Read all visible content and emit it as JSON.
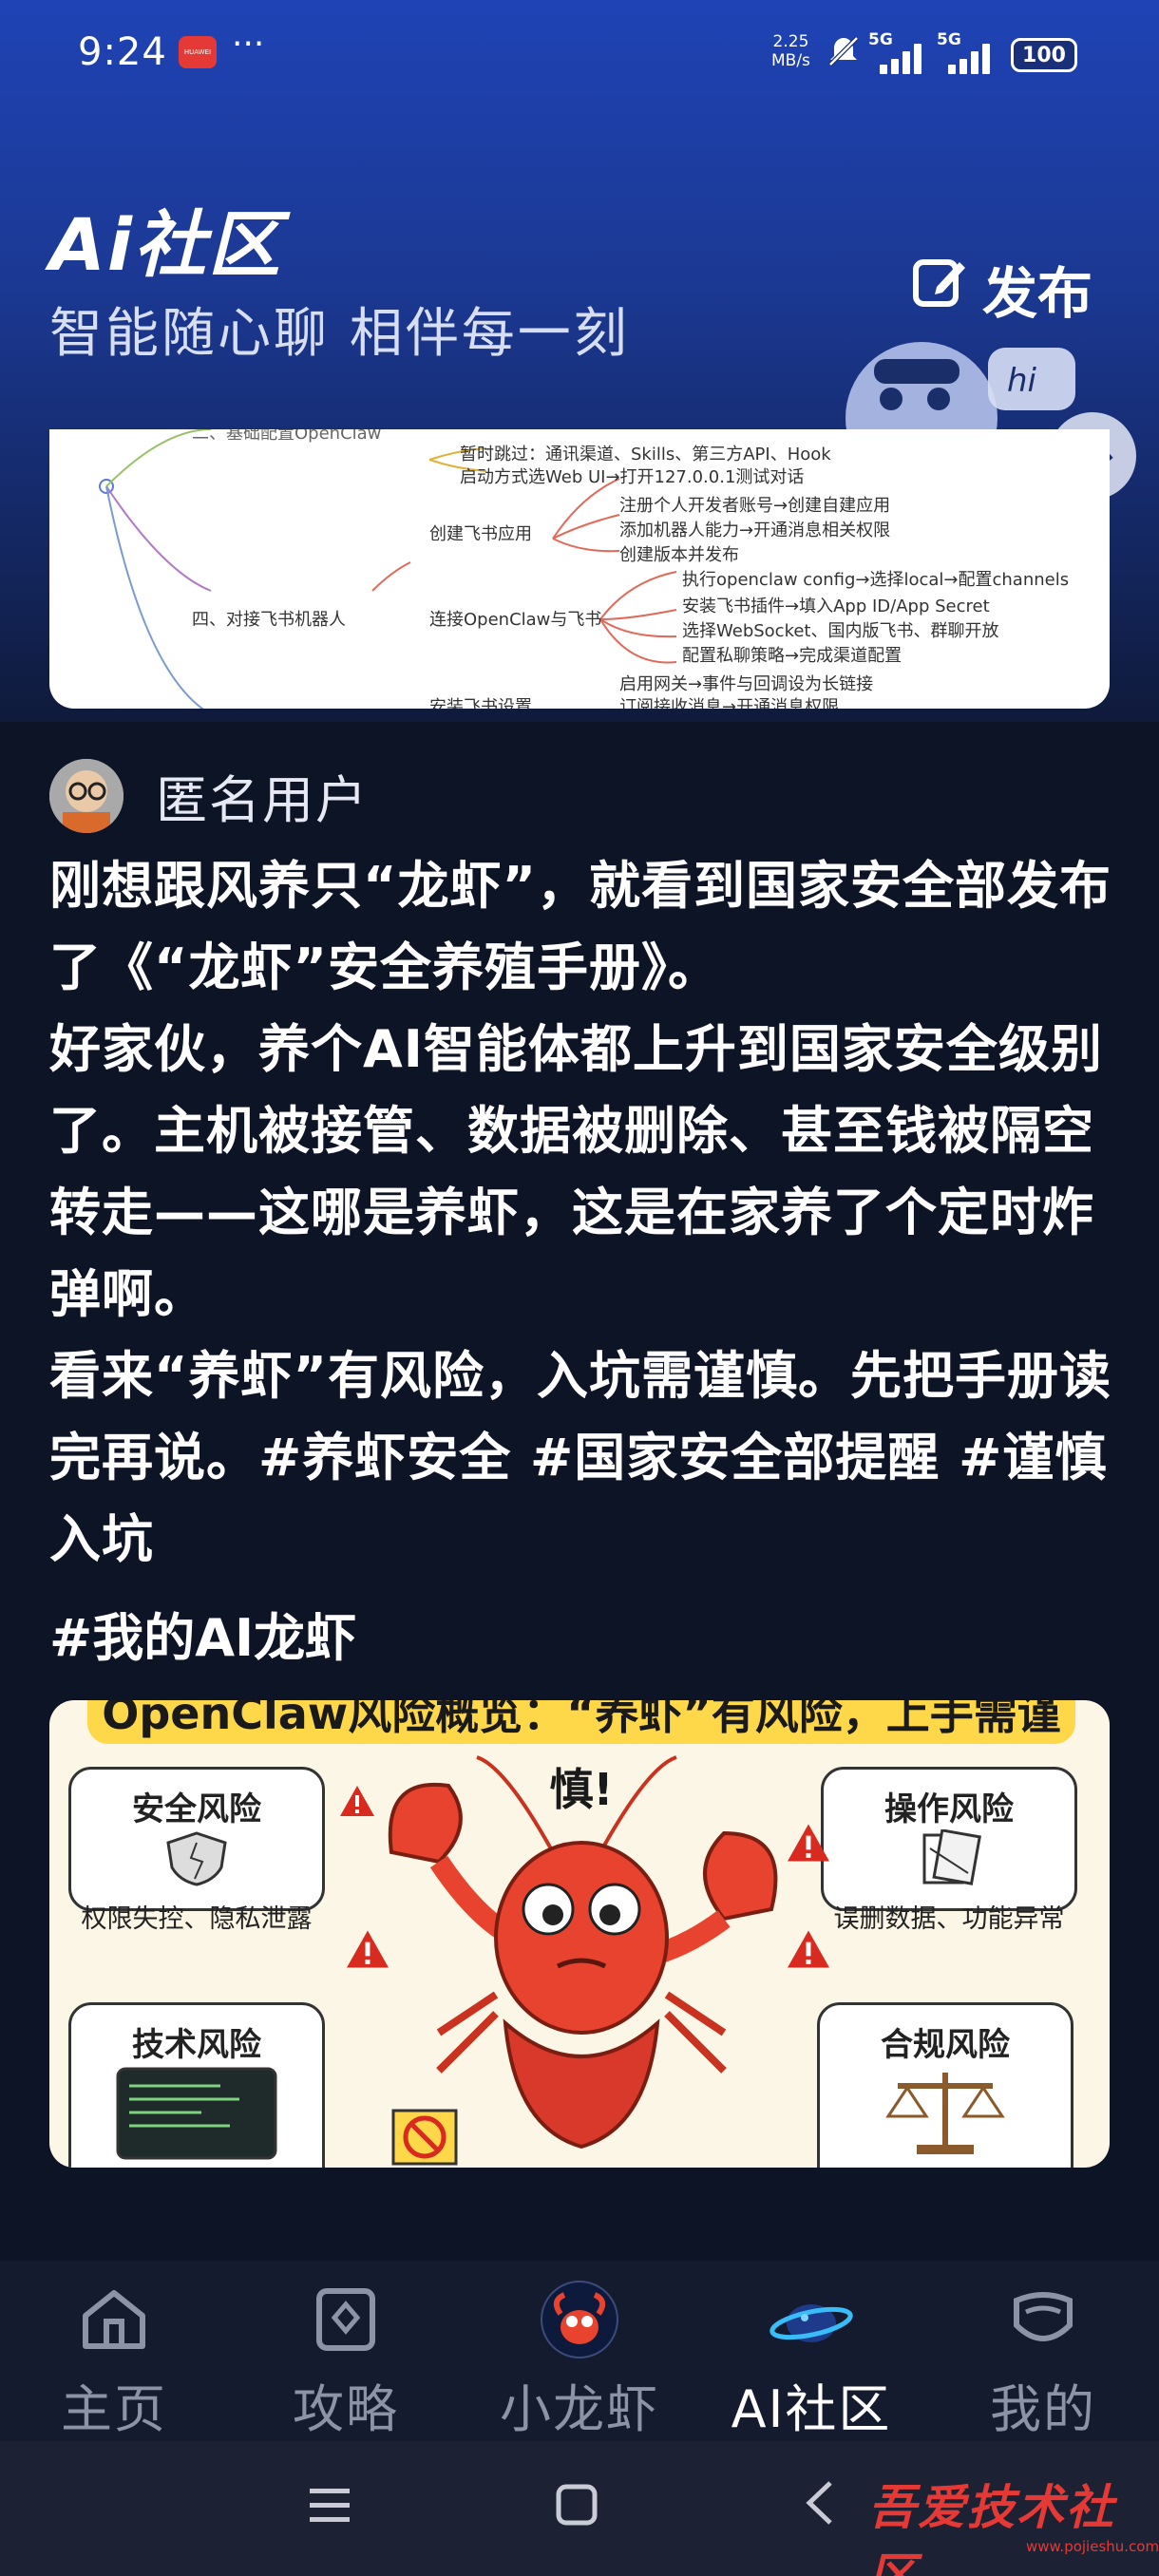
{
  "status_bar": {
    "time": "9:24",
    "app_badge": "HUAWEI",
    "more": "···",
    "net_speed_value": "2.25",
    "net_speed_unit": "MB/s",
    "signal1_label": "5G",
    "signal2_label": "5G",
    "battery": "100"
  },
  "header": {
    "logo": "Ai社区",
    "slogan": "智能随心聊 相伴每一刻",
    "publish_label": "发布"
  },
  "mindmap": {
    "lines": [
      "二、基础配置OpenClaw",
      "暂时跳过：通讯渠道、Skills、第三方API、Hook",
      "启动方式选Web UI→打开127.0.0.1测试对话",
      "注册个人开发者账号→创建自建应用",
      "创建飞书应用",
      "添加机器人能力→开通消息相关权限",
      "创建版本并发布",
      "执行openclaw config→选择local→配置channels",
      "四、对接飞书机器人",
      "连接OpenClaw与飞书",
      "安装飞书插件→填入App ID/App Secret",
      "选择WebSocket、国内版飞书、群聊开放",
      "配置私聊策略→完成渠道配置",
      "启用网关→事件与回调设为长链接",
      "安装飞书设置",
      "订阅接收消息→开通消息权限"
    ]
  },
  "post": {
    "author": "匿名用户",
    "paragraphs": [
      "刚想跟风养只“龙虾”，就看到国家安全部发布了《“龙虾”安全养殖手册》。",
      "好家伙，养个AI智能体都上升到国家安全级别了。主机被接管、数据被删除、甚至钱被隔空转走——这哪是养虾，这是在家养了个定时炸弹啊。",
      "看来“养虾”有风险，入坑需谨慎。先把手册读完再说。#养虾安全 #国家安全部提醒 #谨慎入坑"
    ],
    "topic": "#我的AI龙虾"
  },
  "poster": {
    "banner": "OpenClaw风险概览：“养虾”有风险，上手需谨慎!",
    "risks": [
      {
        "title": "安全风险",
        "desc": "权限失控、隐私泄露"
      },
      {
        "title": "操作风险",
        "desc": "误删数据、功能异常"
      },
      {
        "title": "技术风险",
        "desc": ""
      },
      {
        "title": "合规风险",
        "desc": ""
      }
    ]
  },
  "nav": {
    "items": [
      {
        "label": "主页",
        "icon": "home-icon"
      },
      {
        "label": "攻略",
        "icon": "guide-icon"
      },
      {
        "label": "小龙虾",
        "icon": "lobster-avatar-icon"
      },
      {
        "label": "AI社区",
        "icon": "community-planet-icon"
      },
      {
        "label": "我的",
        "icon": "profile-icon"
      }
    ],
    "active": "AI社区"
  },
  "watermark": {
    "text": "吾爱技术社区",
    "url": "www.pojieshu.com"
  },
  "colors": {
    "header_gradient_top": "#1f43b5",
    "page_bg": "#0d1426",
    "nav_bg": "#141b2e",
    "poster_banner": "#ffd84a",
    "lobster_red": "#e8432f",
    "watermark_red": "#e53935"
  }
}
